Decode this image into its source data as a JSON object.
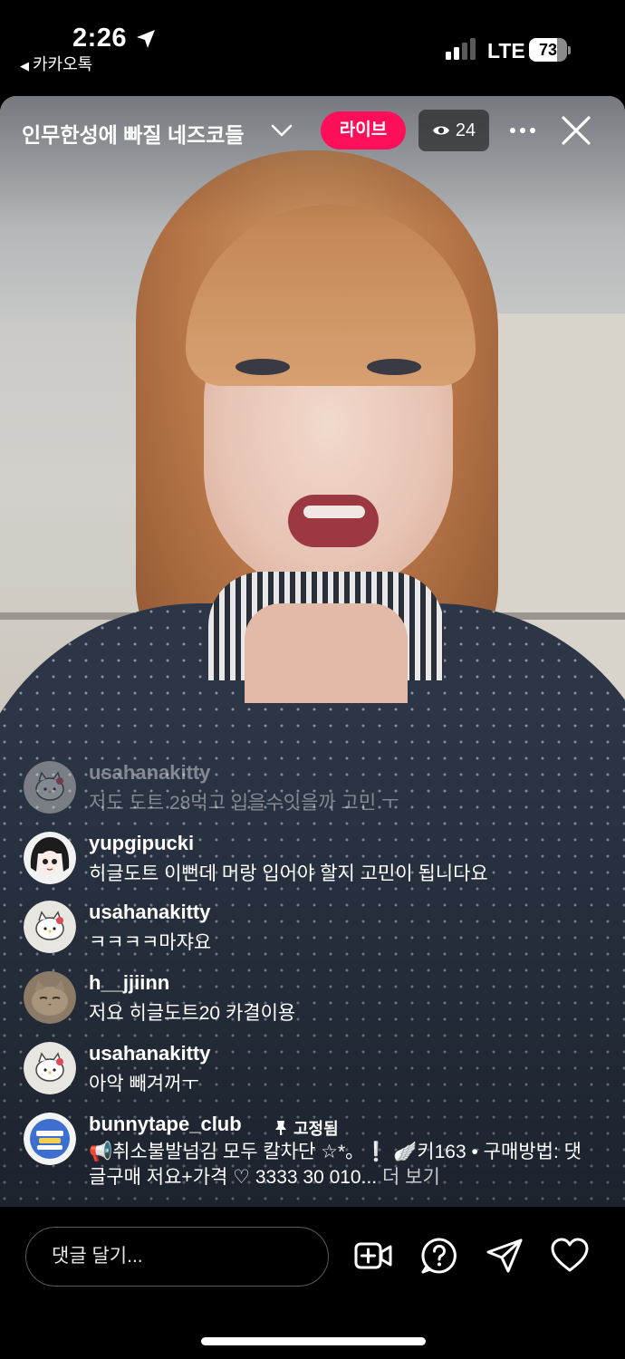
{
  "status_bar": {
    "time": "2:26",
    "back_app": "카카오톡",
    "network": "LTE",
    "battery_pct": "73",
    "battery_level": 0.73
  },
  "header": {
    "title": "인무한성에 빠질 네즈코들",
    "live_badge": "라이브",
    "viewer_count": "24"
  },
  "comments": [
    {
      "user": "usahanakitty",
      "text": "저도 도트 28먹고 입을수잇을까 고민 ㅜ",
      "avatar": "hello-kitty-avatar"
    },
    {
      "user": "yupgipucki",
      "text": "히글도트 이뻔데 머랑 입어야 할지 고민이 됩니다요",
      "avatar": "anime-girl-avatar"
    },
    {
      "user": "usahanakitty",
      "text": "ㅋㅋㅋㅋ마쟈요",
      "avatar": "hello-kitty-avatar"
    },
    {
      "user": "h__jjiinn",
      "text": "저요 히글도트20 카결이용",
      "avatar": "cat-avatar"
    },
    {
      "user": "usahanakitty",
      "text": "아악 빼겨꺼ㅜ",
      "avatar": "hello-kitty-avatar"
    }
  ],
  "pinned_comment": {
    "user": "bunnytape_club",
    "pinned_label": "고정됨",
    "text": "📢취소불발넘김 모두 칼차단 ☆*。❕ 🪽키163 • 구매방법: 댓글구매 저요+가격 ♡ 3333 30 010...",
    "more_label": "더 보기",
    "avatar": "bunnytape-logo-avatar"
  },
  "bottom_bar": {
    "comment_placeholder": "댓글 달기..."
  }
}
